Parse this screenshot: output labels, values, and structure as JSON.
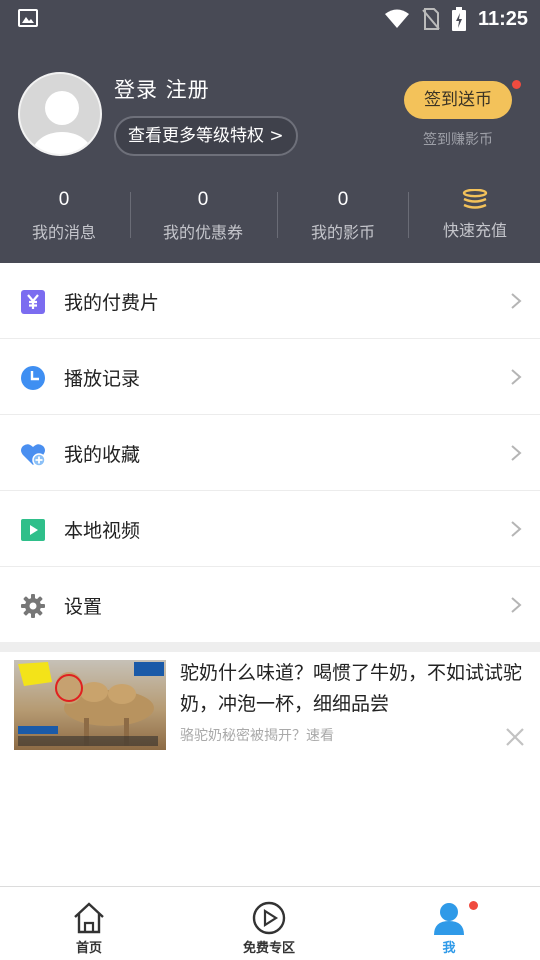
{
  "status_bar": {
    "time": "11:25",
    "icons": [
      "image-icon",
      "wifi-icon",
      "no-sim-icon",
      "battery-charging-icon"
    ]
  },
  "profile": {
    "login_text": "登录 注册",
    "level_button": "查看更多等级特权 >",
    "checkin_button": "签到送币",
    "checkin_sub": "签到赚影币",
    "stats": [
      {
        "value": "0",
        "label": "我的消息"
      },
      {
        "value": "0",
        "label": "我的优惠券"
      },
      {
        "value": "0",
        "label": "我的影币"
      },
      {
        "icon": "coins-icon",
        "label": "快速充值"
      }
    ]
  },
  "menu": [
    {
      "label": "我的付费片",
      "icon": "yen-icon",
      "color": "#7b6cf0"
    },
    {
      "label": "播放记录",
      "icon": "clock-icon",
      "color": "#3f8ff2"
    },
    {
      "label": "我的收藏",
      "icon": "heart-plus-icon",
      "color": "#4a8ff0"
    },
    {
      "label": "本地视频",
      "icon": "video-play-icon",
      "color": "#2fbf8a"
    },
    {
      "label": "设置",
      "icon": "gear-icon",
      "color": "#777777"
    }
  ],
  "ad": {
    "title": "驼奶什么味道？喝惯了牛奶，不如试试驼奶，冲泡一杯，细细品尝",
    "subtitle": "骆驼奶秘密被揭开？速看"
  },
  "bottom_nav": [
    {
      "label": "首页",
      "icon": "home-icon"
    },
    {
      "label": "免费专区",
      "icon": "play-circle-icon"
    },
    {
      "label": "我",
      "icon": "person-icon",
      "active": true
    }
  ],
  "colors": {
    "header_bg": "#484a55",
    "accent": "#f3c25a",
    "badge": "#f04b3f",
    "active_nav": "#2f9ae8"
  }
}
